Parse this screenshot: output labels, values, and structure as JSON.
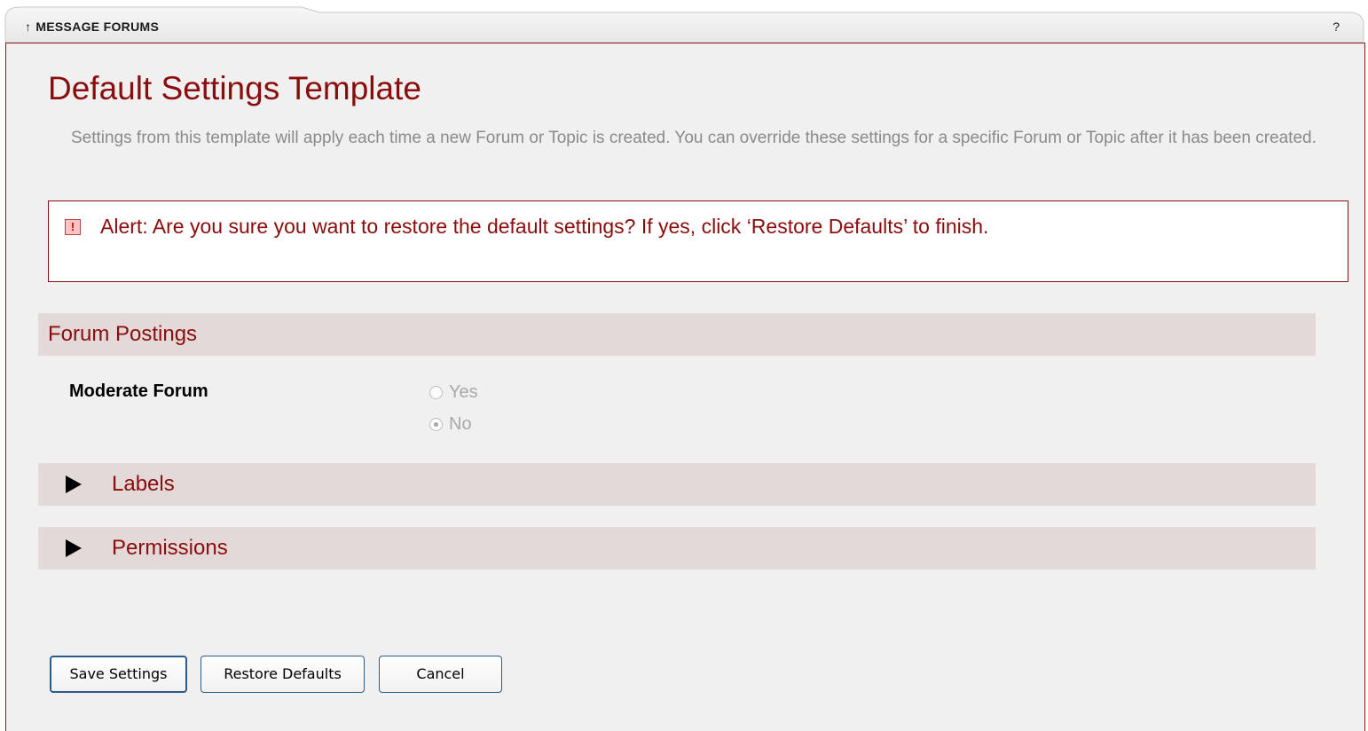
{
  "tab": {
    "title": "MESSAGE FORUMS",
    "arrow": "↑",
    "help": "?"
  },
  "page": {
    "title": "Default Settings Template",
    "description": "Settings from this template will apply each time a new Forum or Topic is created.  You can override these settings for a specific Forum or Topic after it has been created."
  },
  "alert": {
    "icon": "!",
    "text": "Alert: Are you sure you want to restore the default settings?  If yes, click ‘Restore Defaults’ to finish."
  },
  "sections": {
    "forum_postings": {
      "title": "Forum Postings",
      "setting_label": "Moderate Forum",
      "options": {
        "yes": "Yes",
        "no": "No"
      },
      "selected": "No"
    },
    "labels": {
      "title": "Labels",
      "expanded": false
    },
    "permissions": {
      "title": "Permissions",
      "expanded": false
    }
  },
  "buttons": {
    "save": "Save Settings",
    "restore": "Restore Defaults",
    "cancel": "Cancel"
  },
  "colors": {
    "accent": "#8b0c0c",
    "section_bg": "#e3d9d9",
    "panel_bg": "#f0f0f0",
    "muted_text": "#8a8a8a",
    "button_border": "#2e5a8a"
  }
}
